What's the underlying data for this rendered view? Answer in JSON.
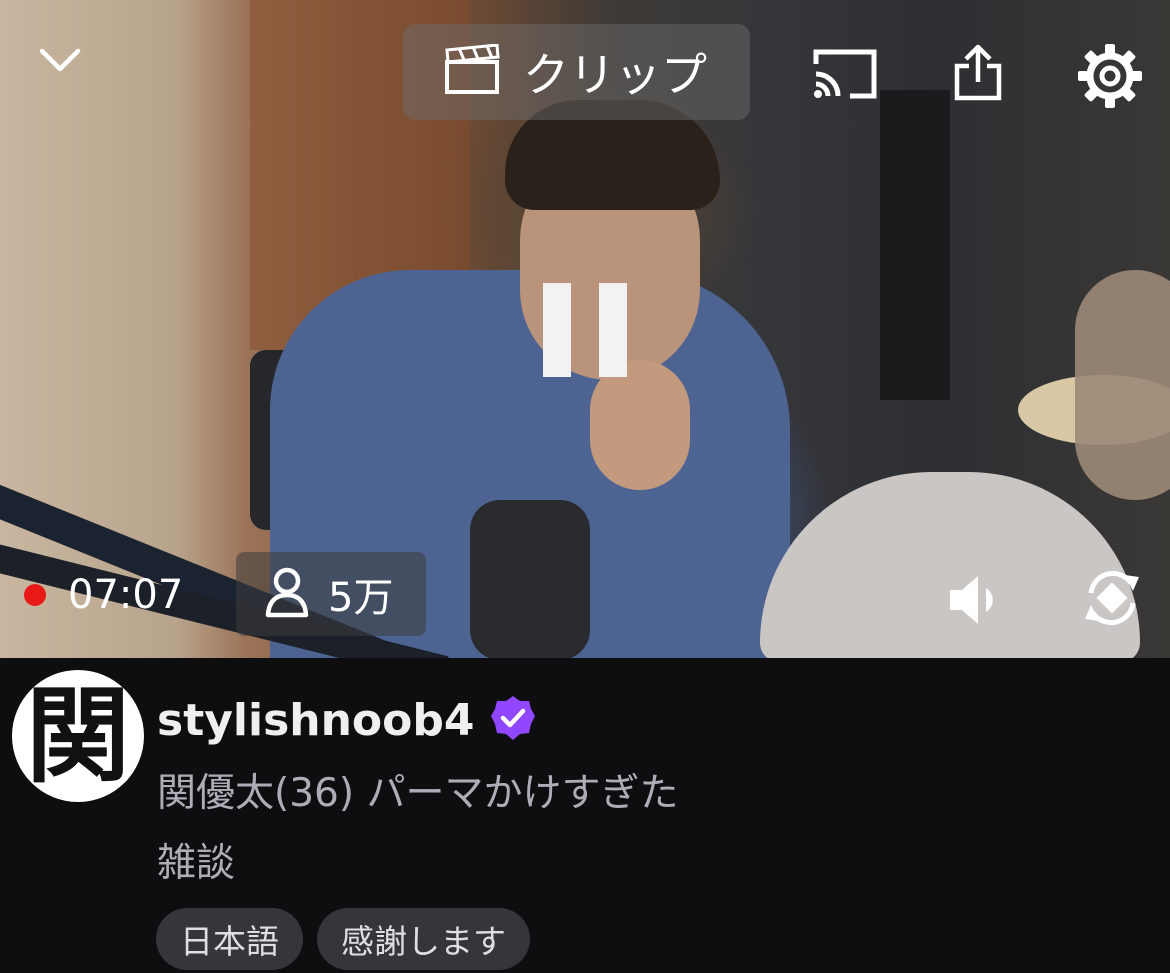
{
  "app": {
    "accent": "#9147ff",
    "live_color": "#e91916"
  },
  "player": {
    "state": "paused",
    "clip_label": "クリップ",
    "elapsed": "07:07",
    "viewers": "5万",
    "icons": {
      "collapse": "chevron-down-icon",
      "clip": "clapperboard-icon",
      "cast": "cast-icon",
      "share": "share-icon",
      "settings": "gear-icon",
      "center": "pause-icon",
      "viewers": "person-icon",
      "volume": "volume-icon",
      "rotate": "rotate-screen-icon"
    }
  },
  "channel": {
    "avatar_text": "関",
    "name": "stylishnoob4",
    "verified": true,
    "title": "関優太(36) パーマかけすぎた",
    "category": "雑談",
    "tags": [
      "日本語",
      "感謝します"
    ]
  }
}
